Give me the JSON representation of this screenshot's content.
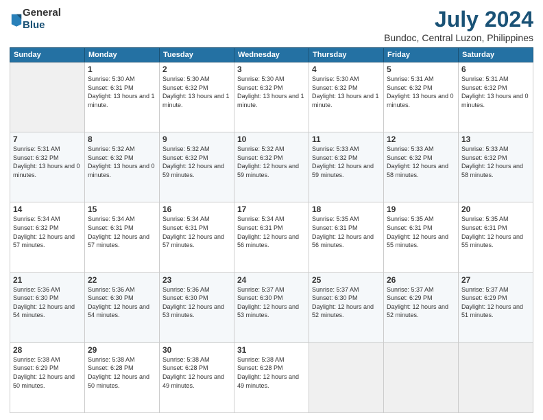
{
  "logo": {
    "line1": "General",
    "line2": "Blue"
  },
  "title": "July 2024",
  "subtitle": "Bundoc, Central Luzon, Philippines",
  "weekdays": [
    "Sunday",
    "Monday",
    "Tuesday",
    "Wednesday",
    "Thursday",
    "Friday",
    "Saturday"
  ],
  "weeks": [
    [
      {
        "day": null
      },
      {
        "day": 1,
        "sunrise": "5:30 AM",
        "sunset": "6:31 PM",
        "daylight": "13 hours and 1 minute."
      },
      {
        "day": 2,
        "sunrise": "5:30 AM",
        "sunset": "6:32 PM",
        "daylight": "13 hours and 1 minute."
      },
      {
        "day": 3,
        "sunrise": "5:30 AM",
        "sunset": "6:32 PM",
        "daylight": "13 hours and 1 minute."
      },
      {
        "day": 4,
        "sunrise": "5:30 AM",
        "sunset": "6:32 PM",
        "daylight": "13 hours and 1 minute."
      },
      {
        "day": 5,
        "sunrise": "5:31 AM",
        "sunset": "6:32 PM",
        "daylight": "13 hours and 0 minutes."
      },
      {
        "day": 6,
        "sunrise": "5:31 AM",
        "sunset": "6:32 PM",
        "daylight": "13 hours and 0 minutes."
      }
    ],
    [
      {
        "day": 7,
        "sunrise": "5:31 AM",
        "sunset": "6:32 PM",
        "daylight": "13 hours and 0 minutes."
      },
      {
        "day": 8,
        "sunrise": "5:32 AM",
        "sunset": "6:32 PM",
        "daylight": "13 hours and 0 minutes."
      },
      {
        "day": 9,
        "sunrise": "5:32 AM",
        "sunset": "6:32 PM",
        "daylight": "12 hours and 59 minutes."
      },
      {
        "day": 10,
        "sunrise": "5:32 AM",
        "sunset": "6:32 PM",
        "daylight": "12 hours and 59 minutes."
      },
      {
        "day": 11,
        "sunrise": "5:33 AM",
        "sunset": "6:32 PM",
        "daylight": "12 hours and 59 minutes."
      },
      {
        "day": 12,
        "sunrise": "5:33 AM",
        "sunset": "6:32 PM",
        "daylight": "12 hours and 58 minutes."
      },
      {
        "day": 13,
        "sunrise": "5:33 AM",
        "sunset": "6:32 PM",
        "daylight": "12 hours and 58 minutes."
      }
    ],
    [
      {
        "day": 14,
        "sunrise": "5:34 AM",
        "sunset": "6:32 PM",
        "daylight": "12 hours and 57 minutes."
      },
      {
        "day": 15,
        "sunrise": "5:34 AM",
        "sunset": "6:31 PM",
        "daylight": "12 hours and 57 minutes."
      },
      {
        "day": 16,
        "sunrise": "5:34 AM",
        "sunset": "6:31 PM",
        "daylight": "12 hours and 57 minutes."
      },
      {
        "day": 17,
        "sunrise": "5:34 AM",
        "sunset": "6:31 PM",
        "daylight": "12 hours and 56 minutes."
      },
      {
        "day": 18,
        "sunrise": "5:35 AM",
        "sunset": "6:31 PM",
        "daylight": "12 hours and 56 minutes."
      },
      {
        "day": 19,
        "sunrise": "5:35 AM",
        "sunset": "6:31 PM",
        "daylight": "12 hours and 55 minutes."
      },
      {
        "day": 20,
        "sunrise": "5:35 AM",
        "sunset": "6:31 PM",
        "daylight": "12 hours and 55 minutes."
      }
    ],
    [
      {
        "day": 21,
        "sunrise": "5:36 AM",
        "sunset": "6:30 PM",
        "daylight": "12 hours and 54 minutes."
      },
      {
        "day": 22,
        "sunrise": "5:36 AM",
        "sunset": "6:30 PM",
        "daylight": "12 hours and 54 minutes."
      },
      {
        "day": 23,
        "sunrise": "5:36 AM",
        "sunset": "6:30 PM",
        "daylight": "12 hours and 53 minutes."
      },
      {
        "day": 24,
        "sunrise": "5:37 AM",
        "sunset": "6:30 PM",
        "daylight": "12 hours and 53 minutes."
      },
      {
        "day": 25,
        "sunrise": "5:37 AM",
        "sunset": "6:30 PM",
        "daylight": "12 hours and 52 minutes."
      },
      {
        "day": 26,
        "sunrise": "5:37 AM",
        "sunset": "6:29 PM",
        "daylight": "12 hours and 52 minutes."
      },
      {
        "day": 27,
        "sunrise": "5:37 AM",
        "sunset": "6:29 PM",
        "daylight": "12 hours and 51 minutes."
      }
    ],
    [
      {
        "day": 28,
        "sunrise": "5:38 AM",
        "sunset": "6:29 PM",
        "daylight": "12 hours and 50 minutes."
      },
      {
        "day": 29,
        "sunrise": "5:38 AM",
        "sunset": "6:28 PM",
        "daylight": "12 hours and 50 minutes."
      },
      {
        "day": 30,
        "sunrise": "5:38 AM",
        "sunset": "6:28 PM",
        "daylight": "12 hours and 49 minutes."
      },
      {
        "day": 31,
        "sunrise": "5:38 AM",
        "sunset": "6:28 PM",
        "daylight": "12 hours and 49 minutes."
      },
      {
        "day": null
      },
      {
        "day": null
      },
      {
        "day": null
      }
    ]
  ],
  "labels": {
    "sunrise_prefix": "Sunrise: ",
    "sunset_prefix": "Sunset: ",
    "daylight_prefix": "Daylight: "
  }
}
